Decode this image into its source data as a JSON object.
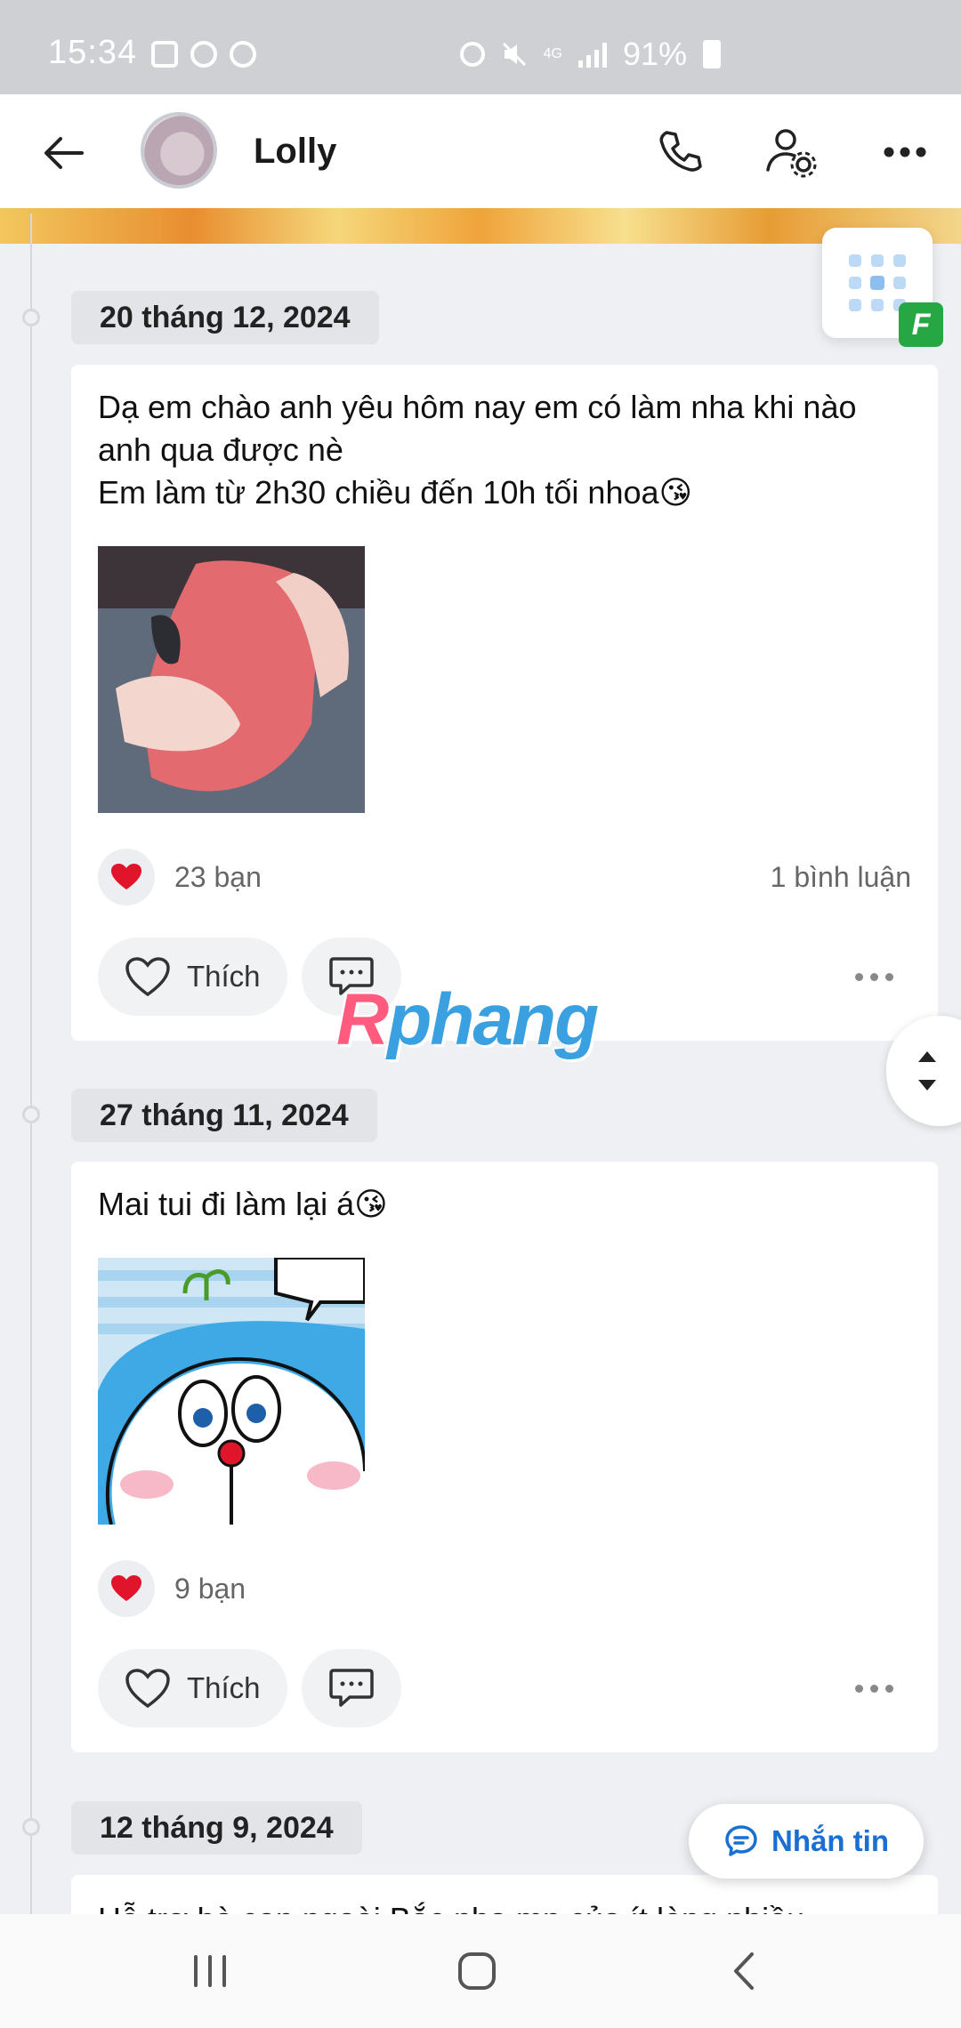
{
  "status_bar": {
    "time": "15:34",
    "network": "4G",
    "battery": "91%"
  },
  "header": {
    "title": "Lolly",
    "icons": [
      "back-arrow-icon",
      "phone-icon",
      "user-settings-icon",
      "more-icon"
    ]
  },
  "posts": [
    {
      "date": "20 tháng 12, 2024",
      "text": "Dạ em chào anh yêu hôm nay em có làm nha khi nào anh qua được nè\nEm làm từ 2h30 chiều đến 10h tối nhoa😘",
      "reactions": "23 bạn",
      "comments": "1 bình luận",
      "like_label": "Thích"
    },
    {
      "date": "27 tháng 11, 2024",
      "text": "Mai tui đi làm lại á😘",
      "reactions": "9 bạn",
      "comments": "",
      "like_label": "Thích"
    },
    {
      "date": "12 tháng 9, 2024",
      "text": "Hỗ trợ bà con ngoài Bắc nha mn của ít lòng nhiều"
    }
  ],
  "watermark": {
    "prefix": "R",
    "rest": "phang"
  },
  "message_button": {
    "label": "Nhắn tin"
  },
  "colors": {
    "accent": "#1a6fd3",
    "heart": "#e0142a",
    "badge_green": "#26a744"
  }
}
